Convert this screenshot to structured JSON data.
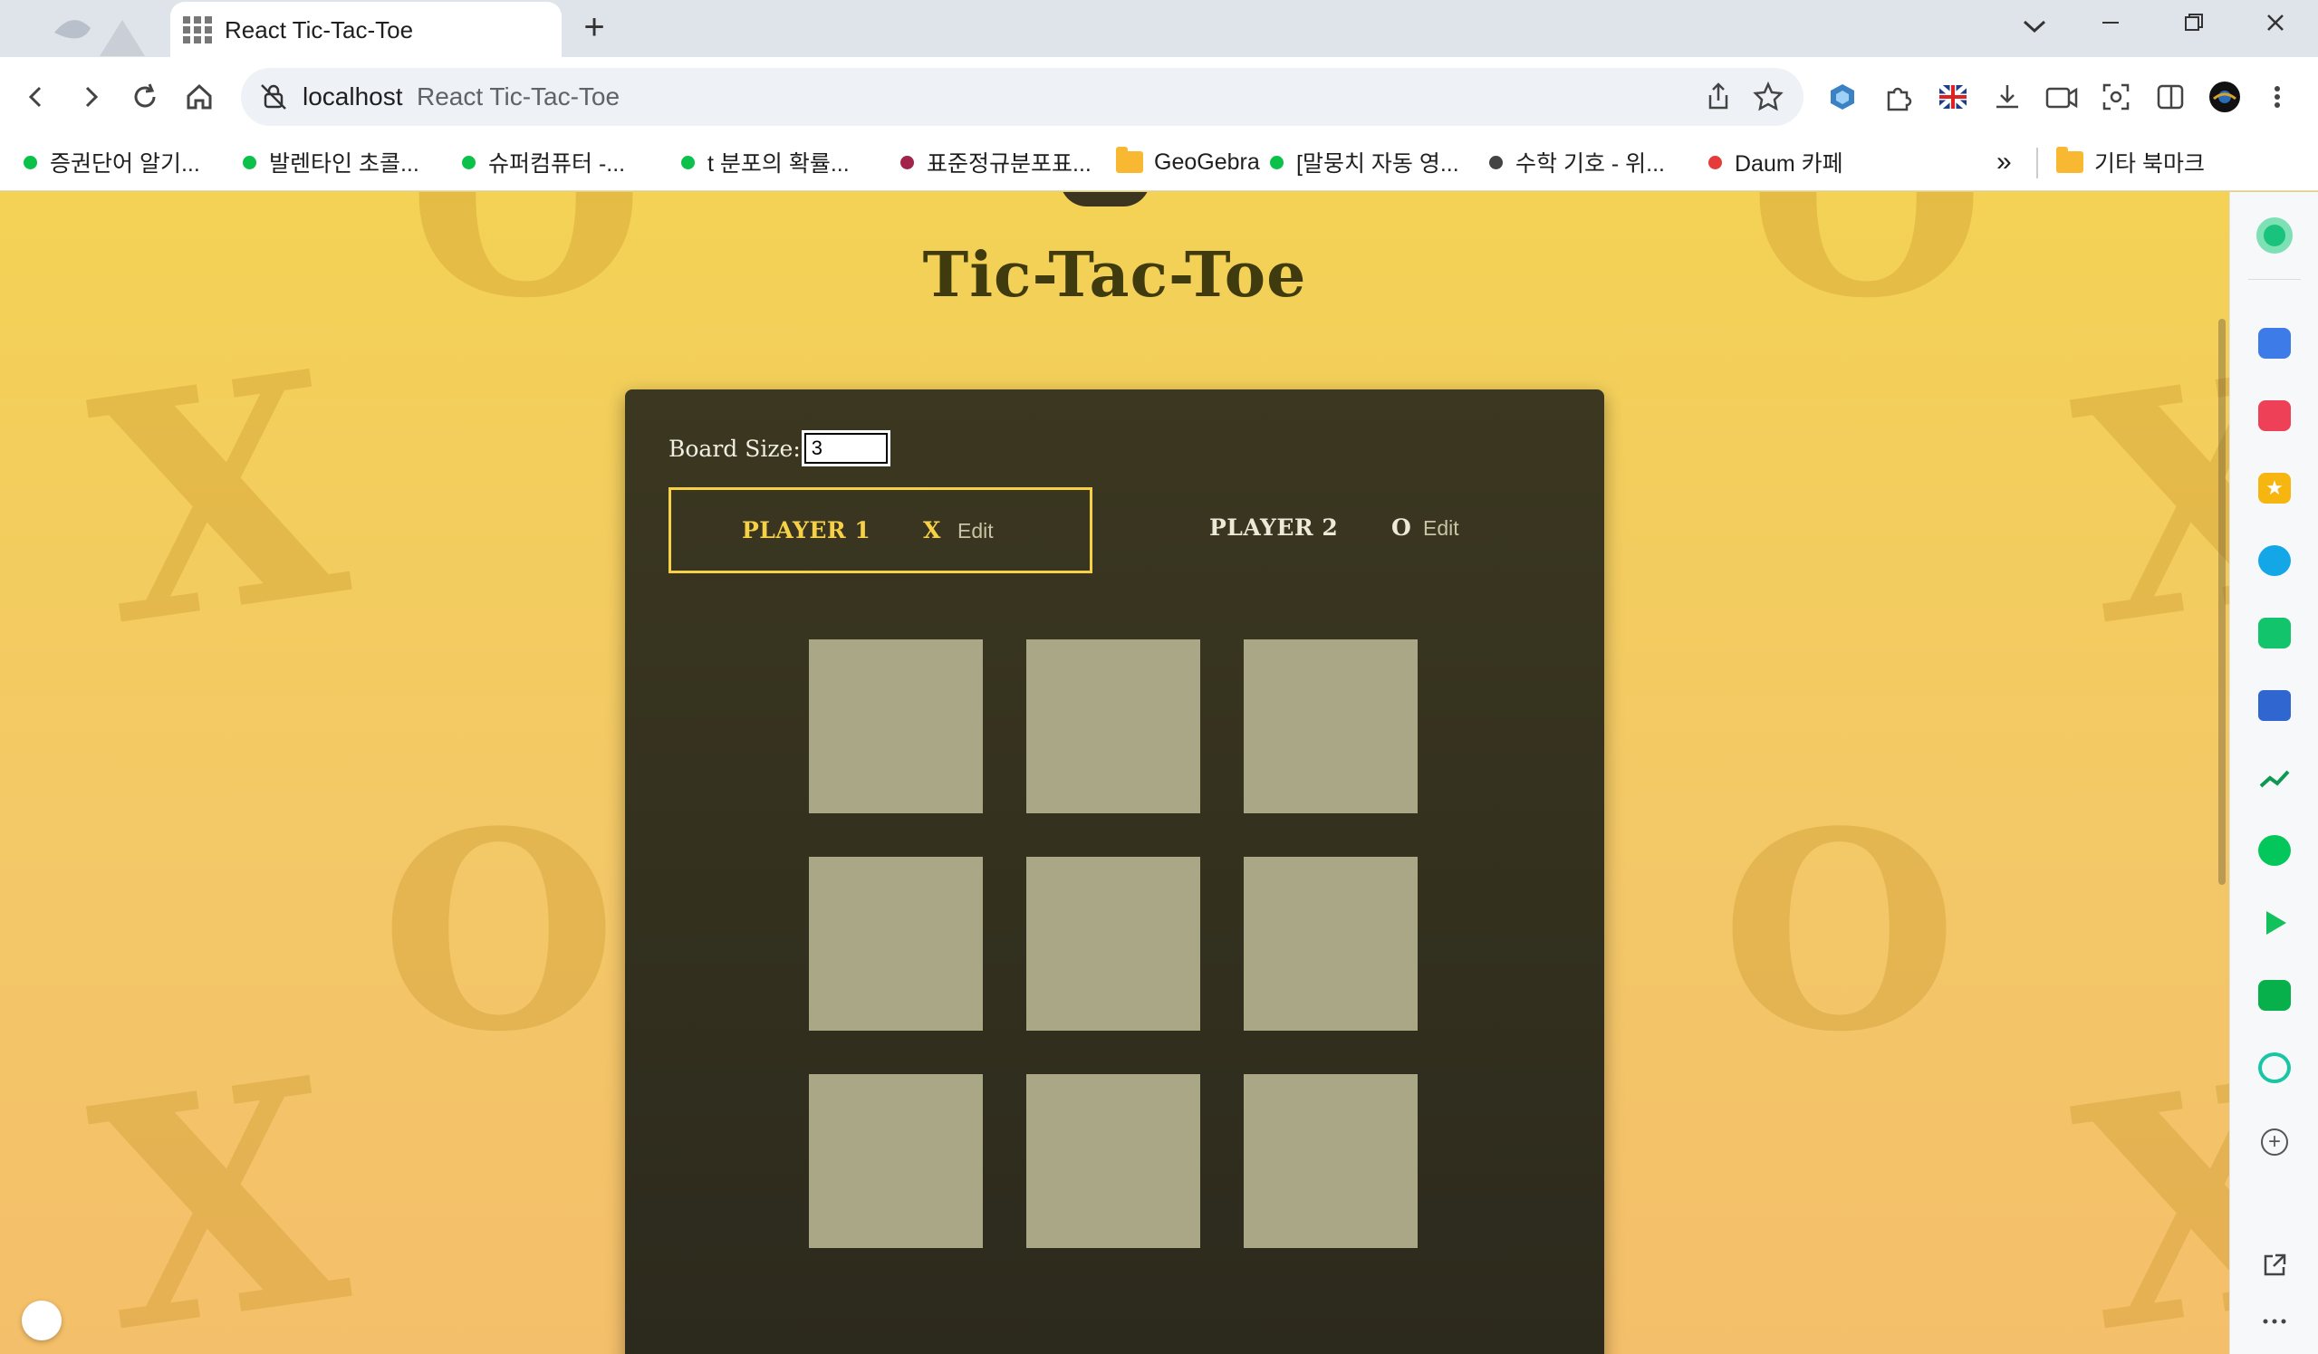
{
  "browser": {
    "tab_title": "React Tic-Tac-Toe",
    "new_tab": "+",
    "url_host": "localhost",
    "url_title": "React Tic-Tac-Toe",
    "bookmarks": [
      {
        "label": "증권단어 알기...",
        "color": "#0bc14a"
      },
      {
        "label": "발렌타인 초콜...",
        "color": "#0bc14a"
      },
      {
        "label": "슈퍼컴퓨터 -...",
        "color": "#0bc14a"
      },
      {
        "label": "t 분포의 확률...",
        "color": "#0bc14a"
      },
      {
        "label": "표준정규분포표...",
        "color": "#a2244a"
      },
      {
        "label": "GeoGebra",
        "folder": true
      },
      {
        "label": "[말뭉치 자동 영...",
        "color": "#0bc14a"
      },
      {
        "label": "수학 기호 - 위...",
        "color": "#444444"
      },
      {
        "label": "Daum 카페",
        "color": "#e53b3b"
      }
    ],
    "more_bookmarks": "»",
    "other_bookmarks": "기타 북마크"
  },
  "app": {
    "title": "Tic-Tac-Toe",
    "board_size_label": "Board Size:",
    "board_size_value": "3",
    "players": [
      {
        "name": "PLAYER 1",
        "symbol": "X",
        "edit": "Edit",
        "active": true
      },
      {
        "name": "PLAYER 2",
        "symbol": "O",
        "edit": "Edit",
        "active": false
      }
    ],
    "board": [
      [
        "",
        "",
        ""
      ],
      [
        "",
        "",
        ""
      ],
      [
        "",
        "",
        ""
      ]
    ]
  },
  "colors": {
    "page_background": "#f2cf55",
    "panel": "#2f2c1e",
    "cell": "#aaa787",
    "active_player": "#f6d046",
    "title": "#3f3b0f"
  }
}
